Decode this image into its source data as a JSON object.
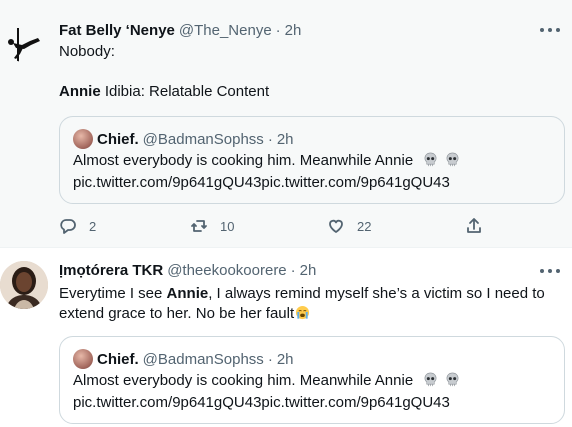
{
  "tweet1": {
    "author_name": "Fat Belly ‘Nenye",
    "handle": "@The_Nenye",
    "separator": "·",
    "time": "2h",
    "line1": "Nobody:",
    "line2_bold": "Annie",
    "line2_rest": " Idibia: Relatable Content",
    "quote": {
      "author_name": "Chief.",
      "handle": "@BadmanSophss",
      "separator": "·",
      "time": "2h",
      "text": "Almost everybody is cooking him. Meanwhile Annie",
      "link": "pic.twitter.com/9p641gQU43pic.twitter.com/9p641gQU43"
    },
    "actions": {
      "reply_count": "2",
      "retweet_count": "10",
      "like_count": "22"
    }
  },
  "tweet2": {
    "author_name": "Ịmọtórera TKR",
    "handle": "@theekookoorere",
    "separator": "·",
    "time": "2h",
    "line1_pre": "Everytime I see ",
    "line1_bold": "Annie",
    "line1_post": ", I always remind myself she’s a victim so I need to",
    "line2": "extend grace to her. No be her fault",
    "quote": {
      "author_name": "Chief.",
      "handle": "@BadmanSophss",
      "separator": "·",
      "time": "2h",
      "text": "Almost everybody is cooking him. Meanwhile Annie",
      "link": "pic.twitter.com/9p641gQU43pic.twitter.com/9p641gQU43"
    }
  },
  "icons": {
    "skull": "skull-emoji",
    "crying": "loudly-crying-emoji",
    "reply": "reply-icon",
    "retweet": "retweet-icon",
    "like": "heart-icon",
    "share": "share-icon",
    "more": "more-dots-icon"
  },
  "colors": {
    "secondary_text": "#536471",
    "border": "#cfd9de",
    "hover_bg": "#f7f9f9"
  }
}
